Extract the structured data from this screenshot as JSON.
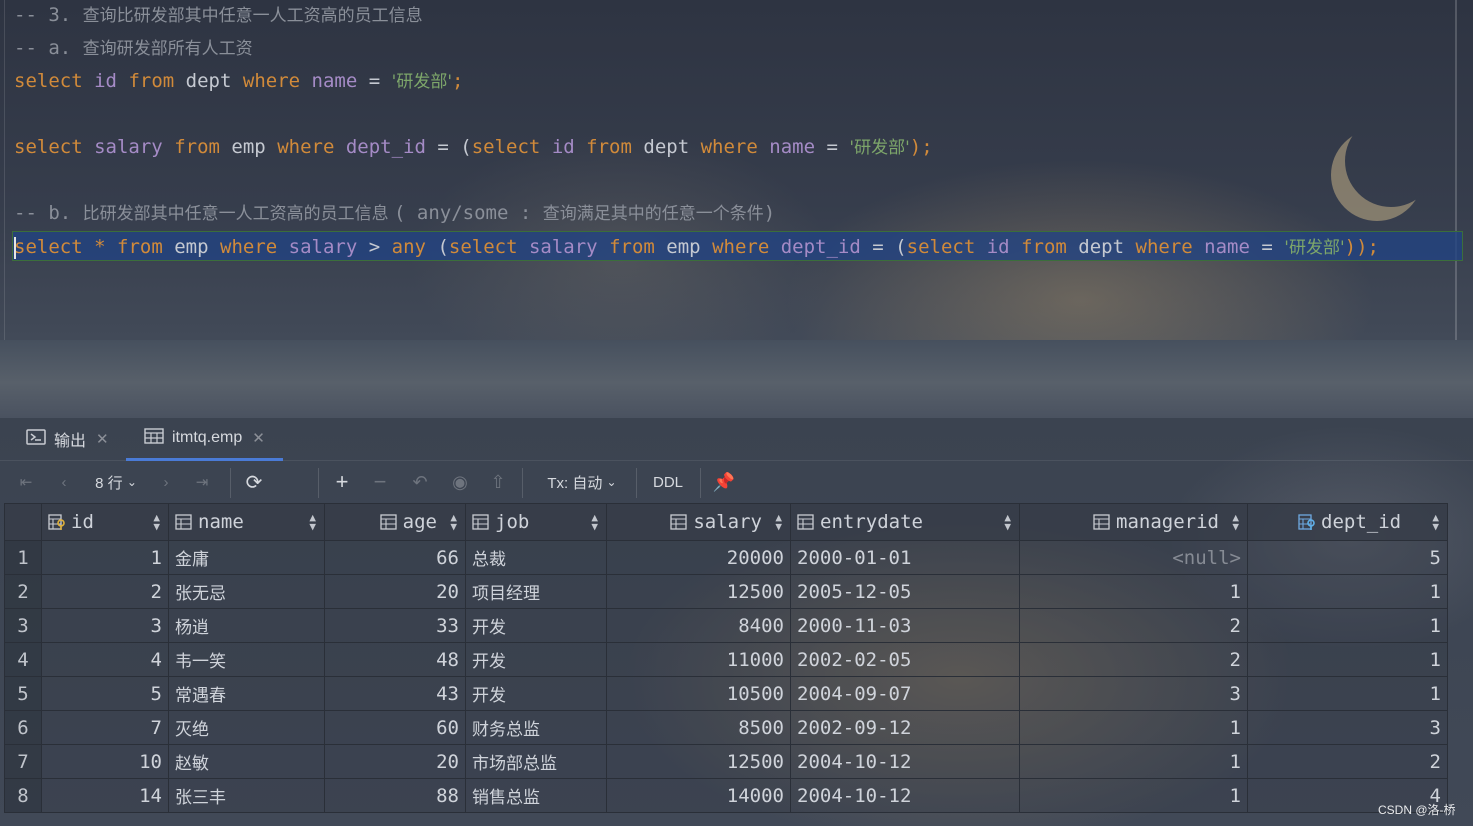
{
  "editor": {
    "line1": {
      "prefix": "-- 3. ",
      "text": "查询比研发部其中任意一人工资高的员工信息"
    },
    "line2": {
      "prefix": "-- a. ",
      "text": "查询研发部所有人工资"
    },
    "line3": {
      "select": "select",
      "id": "id",
      "from": "from",
      "table": "dept",
      "where": "where",
      "col": "name",
      "eq": "=",
      "str": "'研发部'",
      "end": ";"
    },
    "line5": {
      "select": "select",
      "col": "salary",
      "from": "from",
      "table": "emp",
      "where": "where",
      "fk": "dept_id",
      "eq": "=",
      "open": "(",
      "select2": "select",
      "id": "id",
      "from2": "from",
      "table2": "dept",
      "where2": "where",
      "name": "name",
      "eq2": "=",
      "str": "'研发部'",
      "end": ");"
    },
    "line7": {
      "prefix": "-- b. ",
      "text1": "比研发部其中任意一人工资高的员工信息 ",
      "mid": "( any/some : ",
      "text2": "查询满足其中的任意一个条件",
      "close": ")"
    },
    "line8": {
      "s1": "select",
      "star": "*",
      "f1": "from",
      "t1": "emp",
      "w1": "where",
      "c1": "salary",
      "gt": ">",
      "any": "any",
      "p1": "(",
      "s2": "select",
      "c2": "salary",
      "f2": "from",
      "t2": "emp",
      "w2": "where",
      "c3": "dept_id",
      "eq": "=",
      "p2": "(",
      "s3": "select",
      "c4": "id",
      "f3": "from",
      "t3": "dept",
      "w3": "where",
      "c5": "name",
      "eq2": "=",
      "str": "'研发部'",
      "end": "));"
    }
  },
  "tabs": {
    "output": "输出",
    "emp": "itmtq.emp"
  },
  "toolbar": {
    "rows": "8 行",
    "tx": "Tx: 自动",
    "ddl": "DDL"
  },
  "table": {
    "columns": [
      "id",
      "name",
      "age",
      "job",
      "salary",
      "entrydate",
      "managerid",
      "dept_id"
    ],
    "rows": [
      {
        "n": "1",
        "id": "1",
        "name": "金庸",
        "age": "66",
        "job": "总裁",
        "salary": "20000",
        "entrydate": "2000-01-01",
        "managerid": "<null>",
        "dept_id": "5"
      },
      {
        "n": "2",
        "id": "2",
        "name": "张无忌",
        "age": "20",
        "job": "项目经理",
        "salary": "12500",
        "entrydate": "2005-12-05",
        "managerid": "1",
        "dept_id": "1"
      },
      {
        "n": "3",
        "id": "3",
        "name": "杨逍",
        "age": "33",
        "job": "开发",
        "salary": "8400",
        "entrydate": "2000-11-03",
        "managerid": "2",
        "dept_id": "1"
      },
      {
        "n": "4",
        "id": "4",
        "name": "韦一笑",
        "age": "48",
        "job": "开发",
        "salary": "11000",
        "entrydate": "2002-02-05",
        "managerid": "2",
        "dept_id": "1"
      },
      {
        "n": "5",
        "id": "5",
        "name": "常遇春",
        "age": "43",
        "job": "开发",
        "salary": "10500",
        "entrydate": "2004-09-07",
        "managerid": "3",
        "dept_id": "1"
      },
      {
        "n": "6",
        "id": "7",
        "name": "灭绝",
        "age": "60",
        "job": "财务总监",
        "salary": "8500",
        "entrydate": "2002-09-12",
        "managerid": "1",
        "dept_id": "3"
      },
      {
        "n": "7",
        "id": "10",
        "name": "赵敏",
        "age": "20",
        "job": "市场部总监",
        "salary": "12500",
        "entrydate": "2004-10-12",
        "managerid": "1",
        "dept_id": "2"
      },
      {
        "n": "8",
        "id": "14",
        "name": "张三丰",
        "age": "88",
        "job": "销售总监",
        "salary": "14000",
        "entrydate": "2004-10-12",
        "managerid": "1",
        "dept_id": "4"
      }
    ]
  },
  "watermark": "CSDN @洛-桥"
}
